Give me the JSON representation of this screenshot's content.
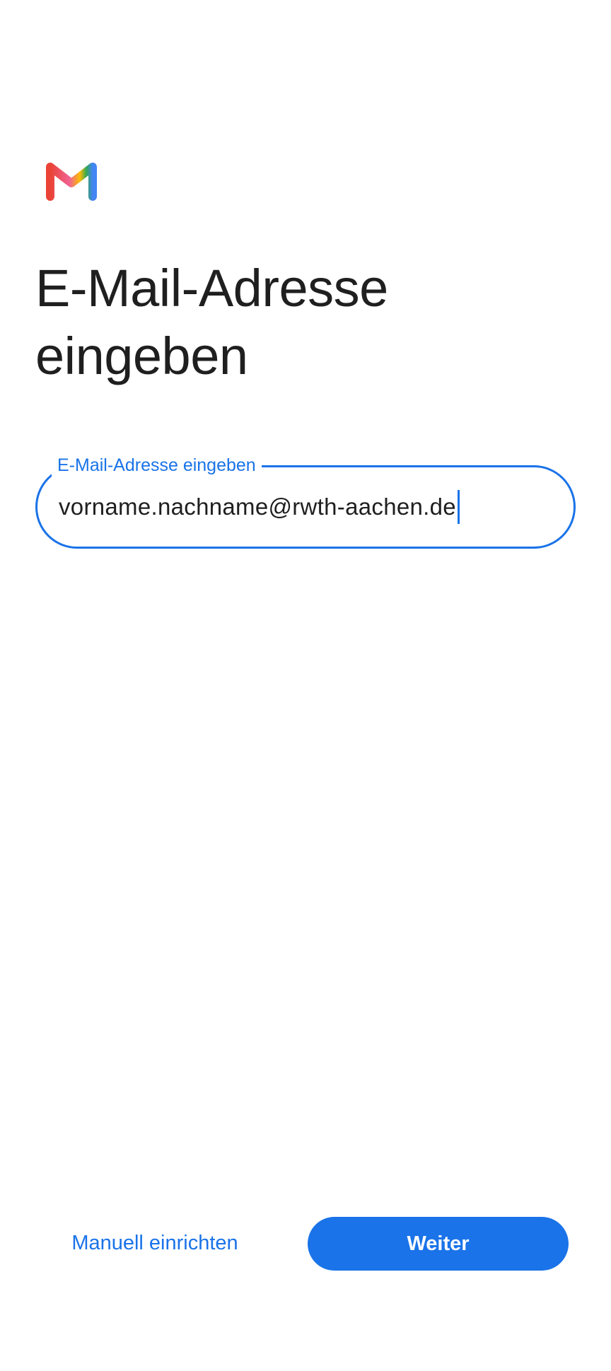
{
  "app": {
    "logo_icon": "gmail-logo-icon"
  },
  "header": {
    "title_line1": "E-Mail-Adresse",
    "title_line2": "eingeben"
  },
  "email_field": {
    "label": "E-Mail-Adresse eingeben",
    "value": "vorname.nachname@rwth-aachen.de"
  },
  "footer": {
    "manual_setup_label": "Manuell einrichten",
    "next_label": "Weiter"
  },
  "colors": {
    "accent": "#1a73e8",
    "text": "#1f1f1f",
    "background": "#ffffff"
  }
}
